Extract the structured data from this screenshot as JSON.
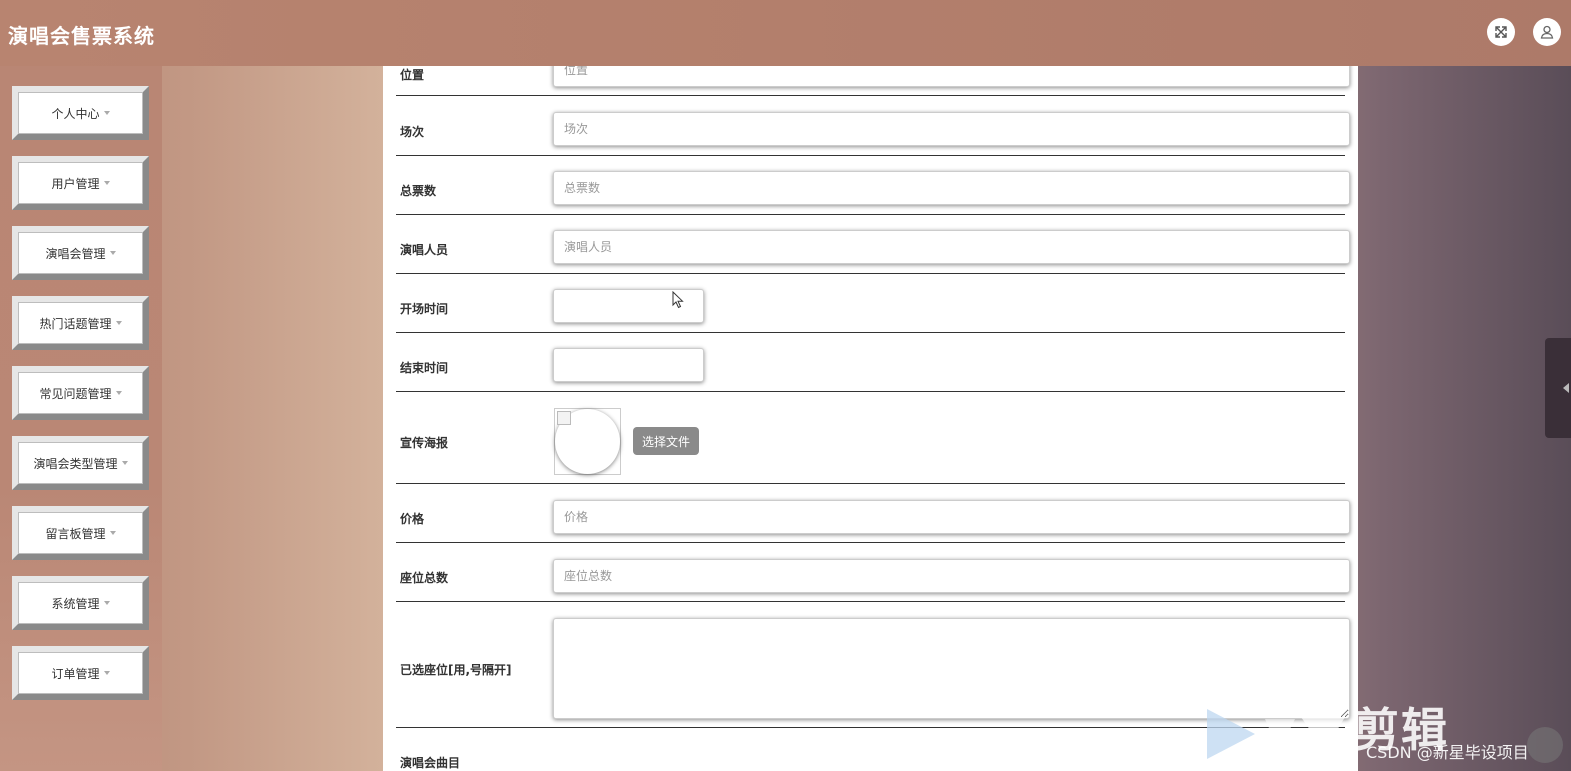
{
  "header": {
    "title": "演唱会售票系统",
    "icons": [
      "fullscreen-icon",
      "user-icon"
    ]
  },
  "sidebar": {
    "items": [
      {
        "label": "个人中心"
      },
      {
        "label": "用户管理"
      },
      {
        "label": "演唱会管理"
      },
      {
        "label": "热门话题管理"
      },
      {
        "label": "常见问题管理"
      },
      {
        "label": "演唱会类型管理"
      },
      {
        "label": "留言板管理"
      },
      {
        "label": "系统管理"
      },
      {
        "label": "订单管理"
      }
    ]
  },
  "form": {
    "location": {
      "label": "位置",
      "placeholder": "位置"
    },
    "session": {
      "label": "场次",
      "placeholder": "场次"
    },
    "total_tickets": {
      "label": "总票数",
      "placeholder": "总票数"
    },
    "performers": {
      "label": "演唱人员",
      "placeholder": "演唱人员"
    },
    "start_time": {
      "label": "开场时间",
      "value": ""
    },
    "end_time": {
      "label": "结束时间",
      "value": ""
    },
    "poster": {
      "label": "宣传海报",
      "button_label": "选择文件"
    },
    "price": {
      "label": "价格",
      "placeholder": "价格"
    },
    "seat_total": {
      "label": "座位总数",
      "placeholder": "座位总数"
    },
    "selected_seats": {
      "label": "已选座位[用,号隔开]",
      "value": ""
    },
    "songs": {
      "label": "演唱会曲目"
    }
  },
  "watermark": {
    "brand": "剪辑",
    "credit": "CSDN @新星毕设项目"
  },
  "colors": {
    "header": "#b37f6c",
    "sidebar": "#b98674",
    "file_button": "#8a8a8a"
  }
}
